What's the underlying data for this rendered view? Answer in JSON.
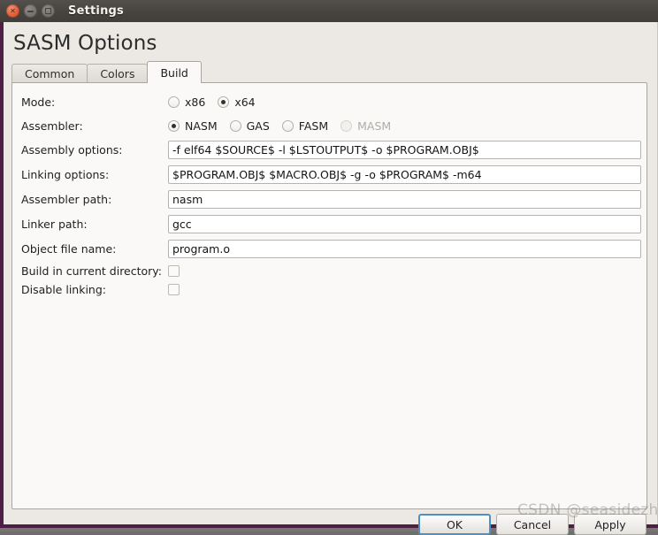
{
  "window": {
    "title": "Settings",
    "controls": [
      {
        "name": "close",
        "glyph": "x"
      },
      {
        "name": "minimize",
        "glyph": "–"
      },
      {
        "name": "maximize",
        "glyph": "□"
      }
    ]
  },
  "heading": "SASM Options",
  "tabs": [
    {
      "label": "Common",
      "active": false
    },
    {
      "label": "Colors",
      "active": false
    },
    {
      "label": "Build",
      "active": true
    }
  ],
  "form": {
    "mode": {
      "label": "Mode:",
      "options": [
        {
          "label": "x86",
          "checked": false,
          "disabled": false
        },
        {
          "label": "x64",
          "checked": true,
          "disabled": false
        }
      ]
    },
    "assembler": {
      "label": "Assembler:",
      "options": [
        {
          "label": "NASM",
          "checked": true,
          "disabled": false
        },
        {
          "label": "GAS",
          "checked": false,
          "disabled": false
        },
        {
          "label": "FASM",
          "checked": false,
          "disabled": false
        },
        {
          "label": "MASM",
          "checked": false,
          "disabled": true
        }
      ]
    },
    "assembly_options": {
      "label": "Assembly options:",
      "value": "-f elf64 $SOURCE$ -l $LSTOUTPUT$ -o $PROGRAM.OBJ$"
    },
    "linking_options": {
      "label": "Linking options:",
      "value": "$PROGRAM.OBJ$ $MACRO.OBJ$ -g -o $PROGRAM$ -m64"
    },
    "assembler_path": {
      "label": "Assembler path:",
      "value": "nasm"
    },
    "linker_path": {
      "label": "Linker path:",
      "value": "gcc"
    },
    "object_file_name": {
      "label": "Object file name:",
      "value": "program.o"
    },
    "build_in_current_directory": {
      "label": "Build in current directory:",
      "checked": false
    },
    "disable_linking": {
      "label": "Disable linking:",
      "checked": false
    }
  },
  "buttons": {
    "ok": "OK",
    "cancel": "Cancel",
    "apply": "Apply"
  },
  "watermark": "CSDN @seasidezhb",
  "colors": {
    "titlebar": "#48443f",
    "frame_accent": "#4e1f44",
    "window_bg": "#ece9e4",
    "panel_bg": "#fbf9f7",
    "focus_ring": "#4f8fc4",
    "close_button": "#e2603a"
  }
}
